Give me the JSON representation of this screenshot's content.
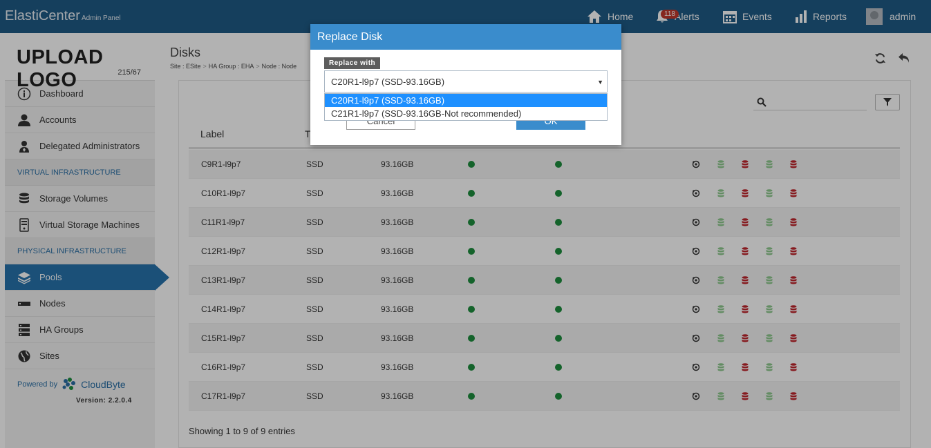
{
  "topbar": {
    "brand": "ElastiCenter",
    "brand_sub": "Admin Panel",
    "nav": {
      "home": "Home",
      "alerts": "Alerts",
      "alerts_count": "118",
      "events": "Events",
      "reports": "Reports",
      "user": "admin"
    }
  },
  "sidebar": {
    "logo_title": "UPLOAD LOGO",
    "logo_dim": "215/67",
    "items_top": [
      {
        "label": "Dashboard",
        "icon": "info-icon"
      },
      {
        "label": "Accounts",
        "icon": "user-icon"
      },
      {
        "label": "Delegated Administrators",
        "icon": "admin-icon"
      }
    ],
    "section_virtual": "VIRTUAL INFRASTRUCTURE",
    "items_virtual": [
      {
        "label": "Storage Volumes",
        "icon": "database-icon"
      },
      {
        "label": "Virtual Storage Machines",
        "icon": "server-icon"
      }
    ],
    "section_physical": "PHYSICAL INFRASTRUCTURE",
    "items_physical": [
      {
        "label": "Pools",
        "icon": "layers-icon",
        "active": true
      },
      {
        "label": "Nodes",
        "icon": "node-icon"
      },
      {
        "label": "HA Groups",
        "icon": "ha-groups-icon"
      },
      {
        "label": "Sites",
        "icon": "globe-icon"
      }
    ],
    "powered_by": "Powered by",
    "powered_brand": "CloudByte",
    "version": "Version: 2.2.0.4"
  },
  "main": {
    "title": "Disks",
    "breadcrumb": [
      "Site : ESite",
      "HA Group : EHA",
      "Node : Node"
    ],
    "columns": [
      "Label",
      "T"
    ],
    "rows": [
      {
        "label": "C9R1-l9p7",
        "type": "SSD",
        "size": "93.16GB"
      },
      {
        "label": "C10R1-l9p7",
        "type": "SSD",
        "size": "93.16GB"
      },
      {
        "label": "C11R1-l9p7",
        "type": "SSD",
        "size": "93.16GB"
      },
      {
        "label": "C12R1-l9p7",
        "type": "SSD",
        "size": "93.16GB"
      },
      {
        "label": "C13R1-l9p7",
        "type": "SSD",
        "size": "93.16GB"
      },
      {
        "label": "C14R1-l9p7",
        "type": "SSD",
        "size": "93.16GB"
      },
      {
        "label": "C15R1-l9p7",
        "type": "SSD",
        "size": "93.16GB"
      },
      {
        "label": "C16R1-l9p7",
        "type": "SSD",
        "size": "93.16GB"
      },
      {
        "label": "C17R1-l9p7",
        "type": "SSD",
        "size": "93.16GB"
      }
    ],
    "footer": "Showing 1 to 9 of 9 entries"
  },
  "modal": {
    "title": "Replace Disk",
    "field_label": "Replace with",
    "selected_value": "C20R1-l9p7 (SSD-93.16GB)",
    "options": [
      "C20R1-l9p7 (SSD-93.16GB)",
      "C21R1-l9p7 (SSD-93.16GB-Not recommended)"
    ],
    "cancel_label": "Cancel",
    "ok_label": "OK"
  },
  "colors": {
    "topbar": "#1f5b86",
    "accent": "#3a8ccc",
    "active_nav": "#2873ad",
    "status_green": "#1e8e3e",
    "danger_red": "#c0262d",
    "disabled_green": "#8fc98f"
  }
}
